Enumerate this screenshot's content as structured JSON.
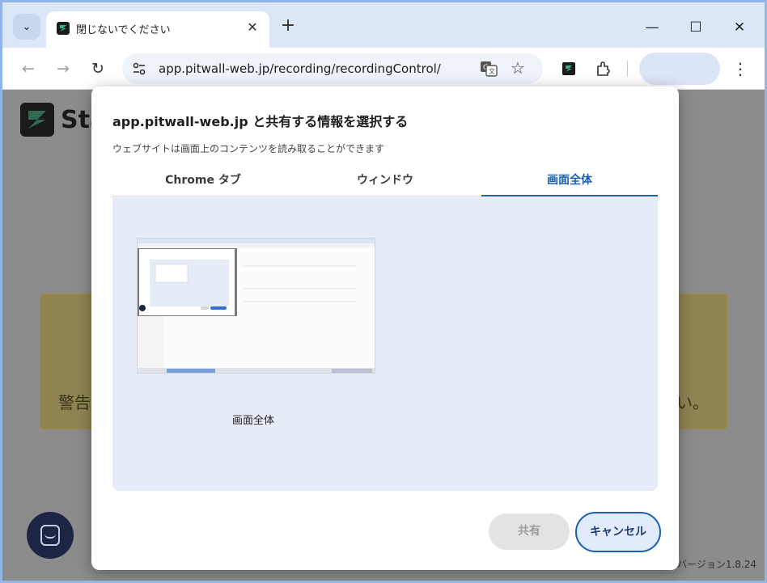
{
  "browser": {
    "tab_title": "閉じないでください",
    "url": "app.pitwall-web.jp/recording/recordingControl/",
    "icons": {
      "tab_menu": "chevron-down-icon",
      "tab_close": "close-icon",
      "new_tab": "plus-icon",
      "minimize": "minimize-icon",
      "maximize": "maximize-icon",
      "close_window": "close-icon",
      "back": "arrow-left-icon",
      "forward": "arrow-right-icon",
      "reload": "reload-icon",
      "site_info": "tune-icon",
      "translate": "translate-icon",
      "bookmark": "star-icon",
      "extension": "extension-icon",
      "puzzle": "puzzle-icon",
      "menu": "more-vert-icon"
    },
    "glyphs": {
      "tab_menu": "⌄",
      "tab_close": "✕",
      "new_tab": "+",
      "minimize": "—",
      "maximize": "☐",
      "close_window": "✕",
      "back": "←",
      "forward": "→",
      "reload": "↻",
      "bookmark": "☆",
      "menu": "⋮"
    }
  },
  "page": {
    "logo_text": "Sta",
    "warning_left": "警告",
    "warning_right": "さい。",
    "version": "バージョン1.8.24"
  },
  "dialog": {
    "title": "app.pitwall-web.jp と共有する情報を選択する",
    "subtitle": "ウェブサイトは画面上のコンテンツを読み取ることができます",
    "tabs": [
      {
        "label": "Chrome タブ",
        "active": false
      },
      {
        "label": "ウィンドウ",
        "active": false
      },
      {
        "label": "画面全体",
        "active": true
      }
    ],
    "screen_option_label": "画面全体",
    "share_label": "共有",
    "cancel_label": "キャンセル"
  },
  "colors": {
    "accent": "#1a5fb4",
    "panel_bg": "#e6ecf7",
    "tabstrip_bg": "#dbe6f6",
    "warning_bg": "#8f8452"
  }
}
